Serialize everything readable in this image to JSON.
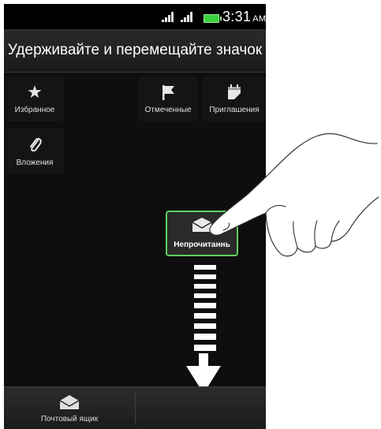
{
  "status_bar": {
    "time": "3:31",
    "ampm": "AM"
  },
  "header": {
    "title": "Удерживайте и перемещайте значок"
  },
  "tiles": {
    "favorites": {
      "label": "Избранное"
    },
    "flagged": {
      "label": "Отмеченные"
    },
    "invitations": {
      "label": "Приглашения"
    },
    "attachments": {
      "label": "Вложения"
    }
  },
  "dragged_tile": {
    "label": "Непрочитаннь"
  },
  "bottom_bar": {
    "mailbox_label": "Почтовый ящик"
  },
  "colors": {
    "highlight": "#5fd15a",
    "battery": "#38d23a"
  },
  "icons": [
    "star-icon",
    "flag-icon",
    "calendar-icon",
    "paperclip-icon",
    "envelope-icon",
    "hand-pointer-icon",
    "arrow-down-icon"
  ]
}
